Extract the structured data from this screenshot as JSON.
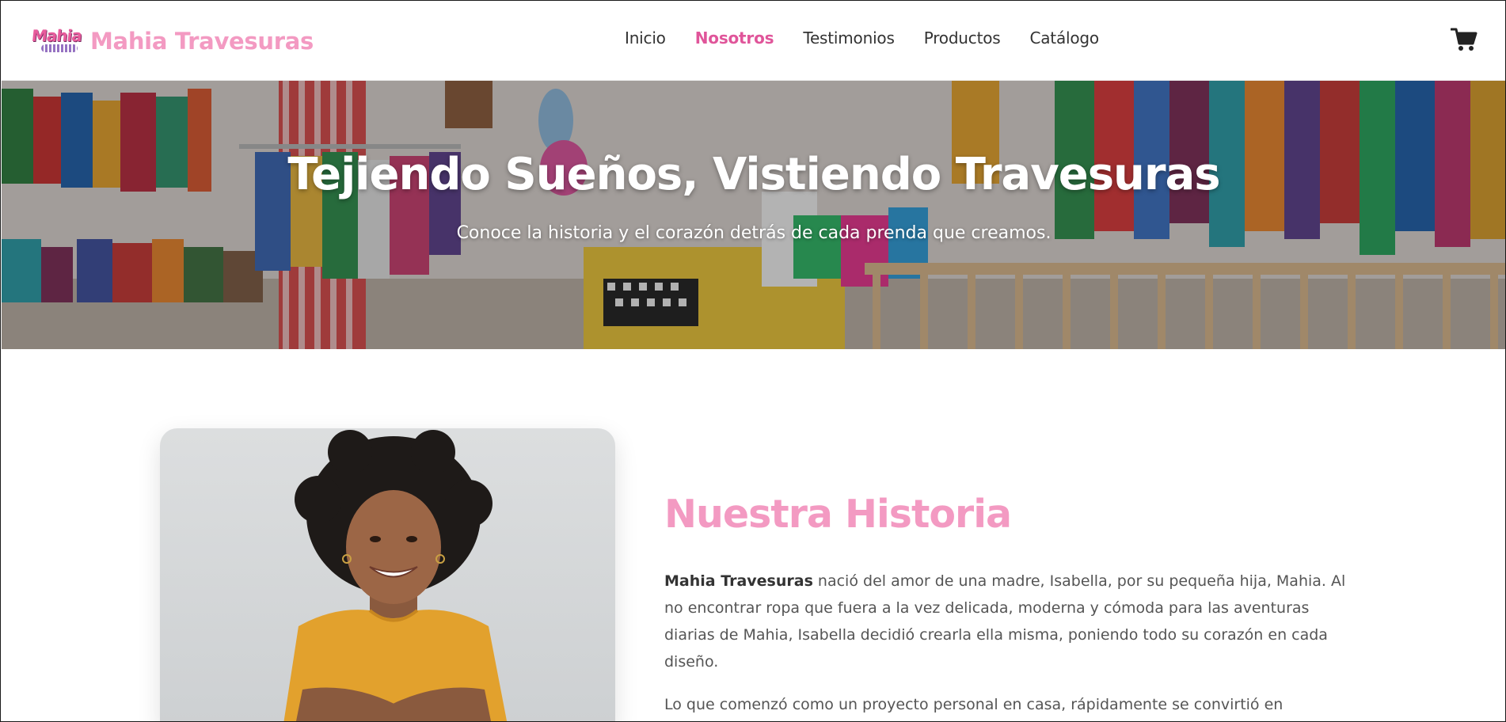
{
  "header": {
    "brand_name": "Mahia Travesuras",
    "logo_text": "Mahia",
    "nav": [
      {
        "label": "Inicio",
        "active": false
      },
      {
        "label": "Nosotros",
        "active": true
      },
      {
        "label": "Testimonios",
        "active": false
      },
      {
        "label": "Productos",
        "active": false
      },
      {
        "label": "Catálogo",
        "active": false
      }
    ],
    "cart_icon": "shopping-cart-icon"
  },
  "hero": {
    "title": "Tejiendo Sueños, Vistiendo Travesuras",
    "subtitle": "Conoce la historia y el corazón detrás de cada prenda que creamos."
  },
  "story": {
    "title": "Nuestra Historia",
    "paragraph1_bold": "Mahia Travesuras",
    "paragraph1_rest": " nació del amor de una madre, Isabella, por su pequeña hija, Mahia. Al no encontrar ropa que fuera a la vez delicada, moderna y cómoda para las aventuras diarias de Mahia, Isabella decidió crearla ella misma, poniendo todo su corazón en cada diseño.",
    "paragraph2": "Lo que comenzó como un proyecto personal en casa, rápidamente se convirtió en"
  },
  "colors": {
    "brand_pink": "#f39ac2",
    "active_nav": "#e0559a",
    "text": "#333333"
  }
}
